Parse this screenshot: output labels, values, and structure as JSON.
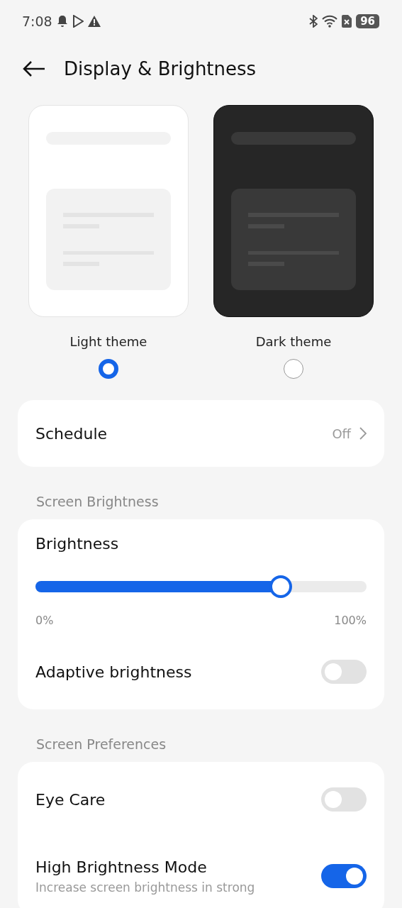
{
  "status_bar": {
    "time": "7:08",
    "battery": "96"
  },
  "header": {
    "title": "Display & Brightness"
  },
  "themes": [
    {
      "label": "Light theme",
      "kind": "light",
      "selected": true
    },
    {
      "label": "Dark theme",
      "kind": "dark",
      "selected": false
    }
  ],
  "schedule": {
    "label": "Schedule",
    "value": "Off"
  },
  "sections": [
    {
      "title": "Screen Brightness",
      "items": [
        {
          "kind": "slider",
          "label": "Brightness",
          "level": 0.74,
          "min_label": "0%",
          "max_label": "100%"
        },
        {
          "kind": "toggle",
          "label": "Adaptive brightness",
          "on": false
        }
      ]
    },
    {
      "title": "Screen Preferences",
      "items": [
        {
          "kind": "toggle",
          "label": "Eye Care",
          "on": false
        },
        {
          "kind": "toggle",
          "label": "High Brightness Mode",
          "description": "Increase screen brightness in strong",
          "on": true
        }
      ]
    }
  ]
}
